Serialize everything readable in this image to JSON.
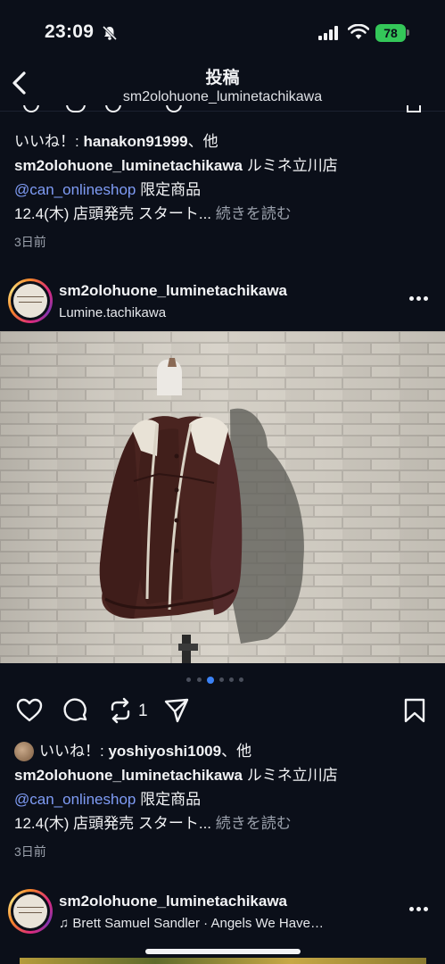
{
  "status_bar": {
    "time": "23:09",
    "battery": "78"
  },
  "header": {
    "title": "投稿",
    "subtitle": "sm2olohuone_luminetachikawa"
  },
  "post1_caption": {
    "likes_label": "いいね！: ",
    "likes_user": "hanakon91999",
    "likes_suffix": "、他",
    "author": "sm2olohuone_luminetachikawa",
    "line1_rest": " ルミネ立川店",
    "mention": "@can_onlineshop",
    "mention_rest": " 限定商品",
    "line3": "12.4(木) 店頭発売 スタート... ",
    "more": "続きを読む",
    "ago": "3日前"
  },
  "post2": {
    "username": "sm2olohuone_luminetachikawa",
    "location": "Lumine.tachikawa",
    "carousel": {
      "count": 6,
      "active_index": 2
    },
    "repost_count": "1",
    "caption": {
      "likes_label": "いいね！: ",
      "likes_user": "yoshiyoshi1009",
      "likes_suffix": "、他",
      "author": "sm2olohuone_luminetachikawa",
      "line1_rest": " ルミネ立川店",
      "mention": "@can_onlineshop",
      "mention_rest": " 限定商品",
      "line3": "12.4(木) 店頭発売 スタート... ",
      "more": "続きを読む",
      "ago": "3日前"
    }
  },
  "post3": {
    "username": "sm2olohuone_luminetachikawa",
    "music": "Brett Samuel Sandler · Angels We Have…"
  },
  "colors": {
    "background": "#0b0f19",
    "mention": "#7f9cf5",
    "carousel_active": "#3b82f6",
    "battery": "#34c759"
  }
}
